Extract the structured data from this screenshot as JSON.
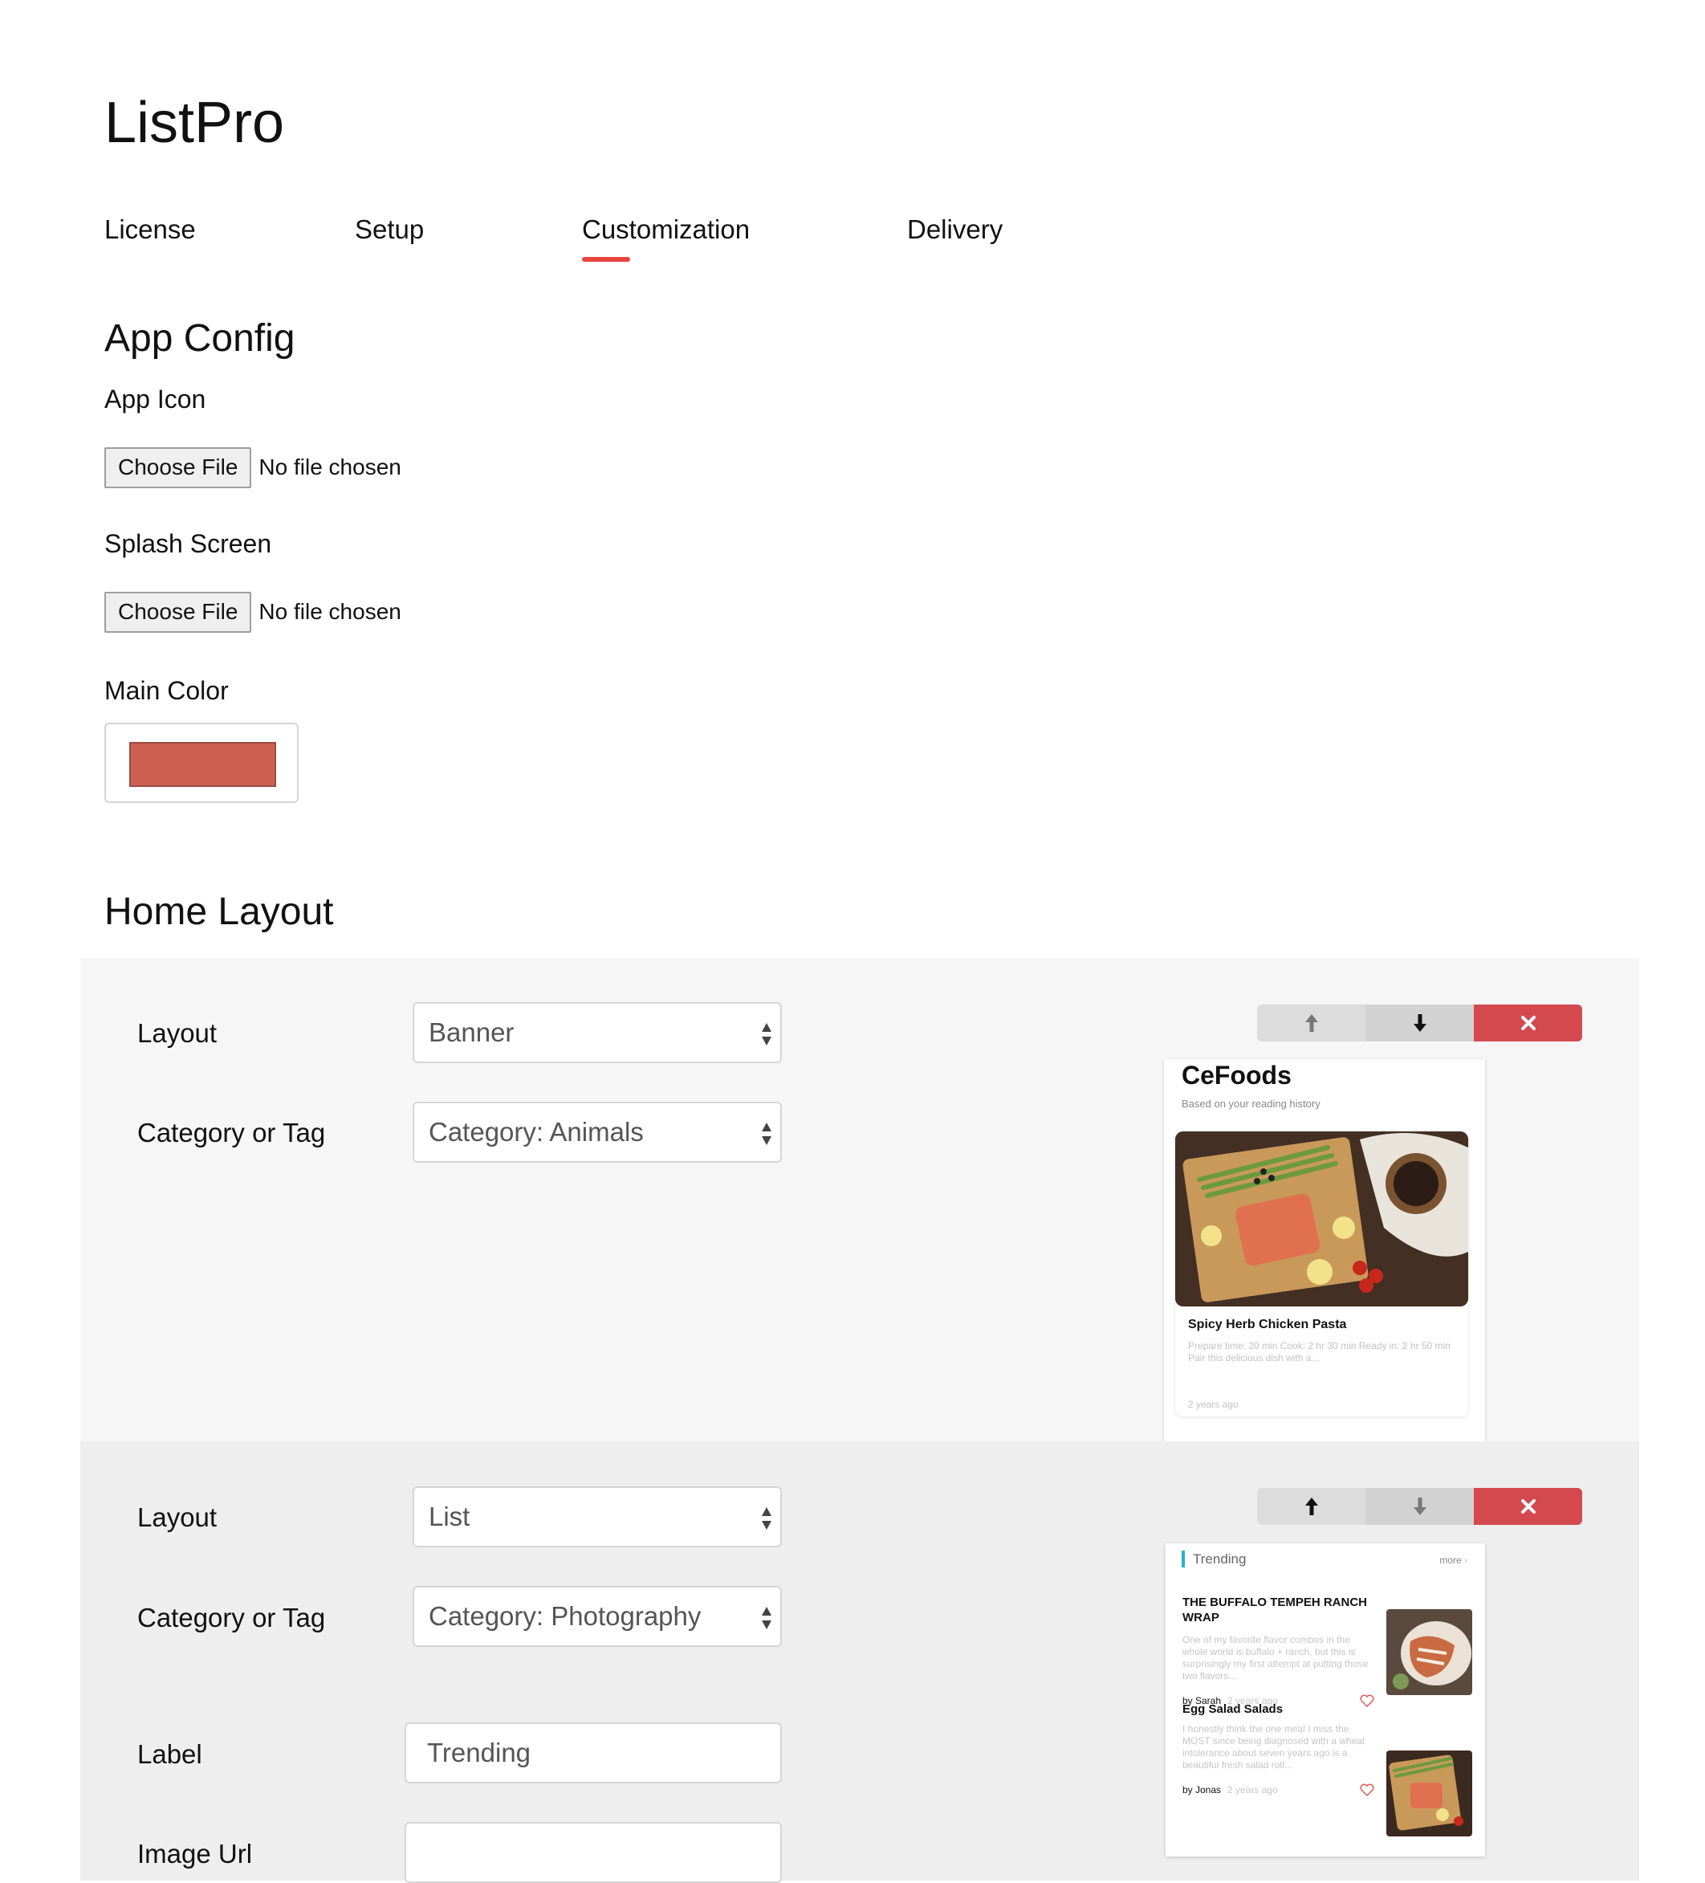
{
  "app": {
    "title": "ListPro"
  },
  "tabs": [
    {
      "label": "License"
    },
    {
      "label": "Setup"
    },
    {
      "label": "Customization",
      "active": true
    },
    {
      "label": "Delivery"
    }
  ],
  "colors": {
    "accent": "#e8453c",
    "main_color": "#ce6052",
    "delete": "#d4494f",
    "trending_bar": "#29b2c4"
  },
  "app_config": {
    "heading": "App Config",
    "app_icon": {
      "label": "App Icon",
      "button": "Choose File",
      "status": "No file chosen"
    },
    "splash_screen": {
      "label": "Splash Screen",
      "button": "Choose File",
      "status": "No file chosen"
    },
    "main_color": {
      "label": "Main Color",
      "value": "#ce6052"
    }
  },
  "home_layout": {
    "heading": "Home Layout",
    "sections": [
      {
        "layout_label": "Layout",
        "layout_value": "Banner",
        "category_label": "Category or Tag",
        "category_value": "Category: Animals",
        "controls": {
          "up": "arrow-up-icon",
          "down": "arrow-down-icon",
          "delete": "close-icon"
        },
        "preview": {
          "title": "CeFoods",
          "subtitle": "Based on your reading history",
          "card_title": "Spicy Herb Chicken Pasta",
          "card_desc": "Prepare time: 20 min Cook: 2 hr 30 min Ready in: 2 hr 50 min Pair this delicious dish with a...",
          "card_time": "2 years ago"
        }
      },
      {
        "layout_label": "Layout",
        "layout_value": "List",
        "category_label": "Category or Tag",
        "category_value": "Category: Photography",
        "label_label": "Label",
        "label_value": "Trending",
        "image_url_label": "Image Url",
        "image_url_value": "",
        "controls": {
          "up": "arrow-up-icon",
          "down": "arrow-down-icon",
          "delete": "close-icon"
        },
        "preview": {
          "label": "Trending",
          "more": "more",
          "items": [
            {
              "title": "THE BUFFALO TEMPEH RANCH WRAP",
              "desc": "One of my favorite flavor combos in the whole world is buffalo + ranch, but this is surprisingly my first attempt at putting those two flavors...",
              "author": "by Sarah",
              "time": "2 years ago"
            },
            {
              "title": "Egg Salad Salads",
              "desc": "I honestly think the one meal I miss the MOST since being diagnosed with a wheat intolerance about seven years ago is a beautiful fresh salad roll...",
              "author": "by Jonas",
              "time": "2 years ago"
            }
          ]
        }
      }
    ]
  }
}
